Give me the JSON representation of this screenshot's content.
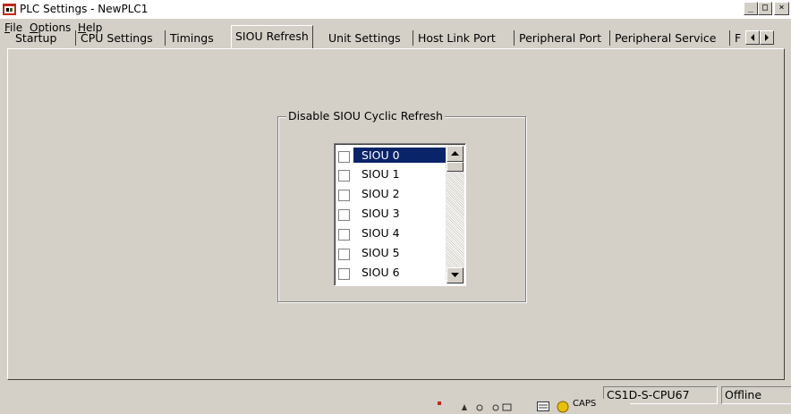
{
  "window": {
    "title": "PLC Settings - NewPLC1",
    "controls": {
      "minimize": "_",
      "maximize": "□",
      "close": "×"
    }
  },
  "menu": {
    "items": [
      {
        "label": "File"
      },
      {
        "label": "Options"
      },
      {
        "label": "Help"
      }
    ]
  },
  "tabs": {
    "items": [
      {
        "label": "Startup"
      },
      {
        "label": "CPU Settings"
      },
      {
        "label": "Timings"
      },
      {
        "label": "SIOU Refresh",
        "active": true
      },
      {
        "label": "Unit Settings"
      },
      {
        "label": "Host Link Port"
      },
      {
        "label": "Peripheral Port"
      },
      {
        "label": "Peripheral Service"
      },
      {
        "label": "F"
      }
    ]
  },
  "siou_refresh": {
    "group_label": "Disable SIOU Cyclic Refresh",
    "list": [
      {
        "label": "SIOU 0",
        "checked": false,
        "selected": true
      },
      {
        "label": "SIOU 1",
        "checked": false
      },
      {
        "label": "SIOU 2",
        "checked": false
      },
      {
        "label": "SIOU 3",
        "checked": false
      },
      {
        "label": "SIOU 4",
        "checked": false
      },
      {
        "label": "SIOU 5",
        "checked": false
      },
      {
        "label": "SIOU 6",
        "checked": false
      }
    ]
  },
  "status": {
    "cpu_model": "CS1D-S-CPU67",
    "mode": "Offline",
    "tray_caps": "CAPS"
  },
  "colors": {
    "face": "#d4d0c8",
    "selection": "#0a246a",
    "title_icon": "#c0281c"
  }
}
